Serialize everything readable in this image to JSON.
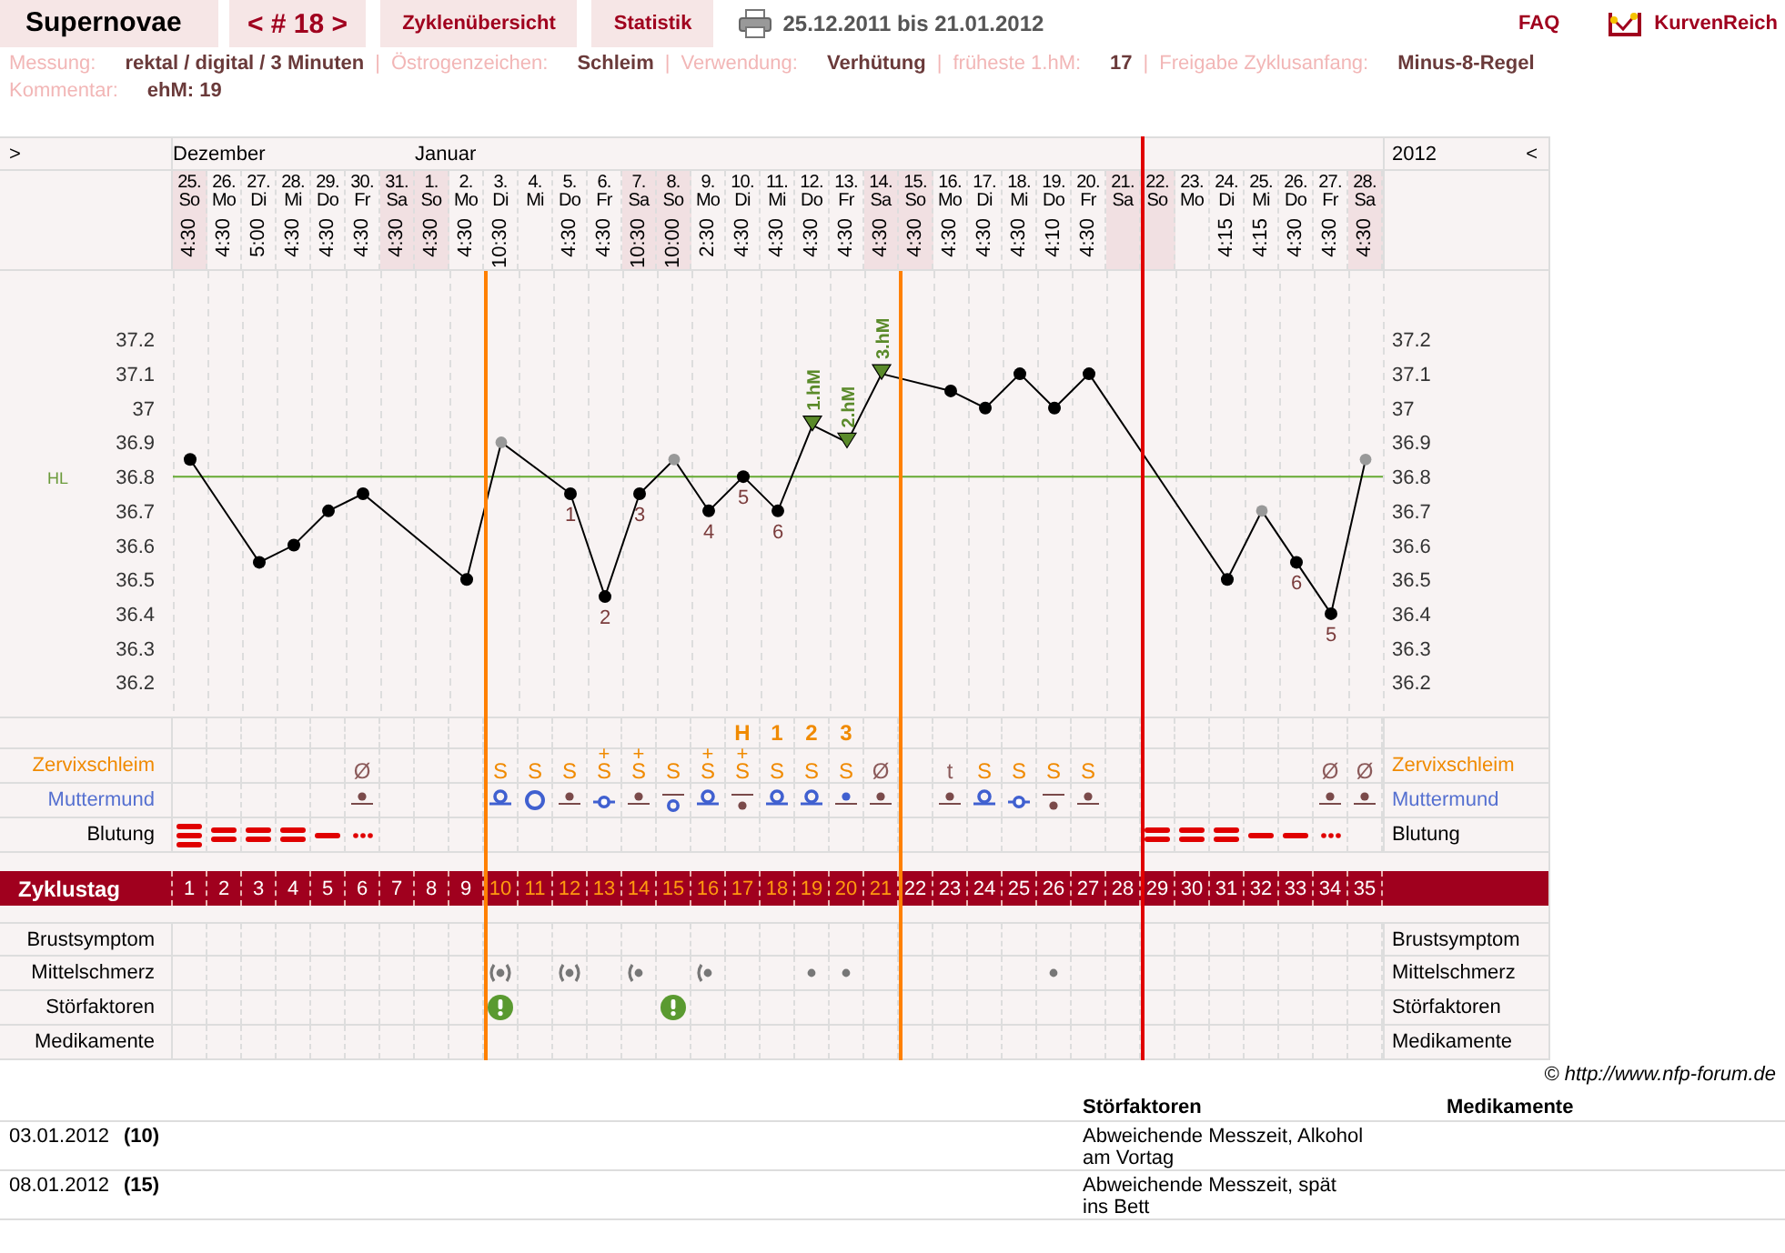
{
  "header": {
    "title": "Supernovae",
    "cycle_nav": "< # 18 >",
    "tabs": [
      {
        "label": "Zyklenübersicht",
        "selected": false
      },
      {
        "label": "Statistik",
        "selected": false
      }
    ],
    "date_range": "25.12.2011 bis 21.01.2012",
    "faq": "FAQ",
    "logo": "KurvenReich"
  },
  "info": [
    [
      {
        "label": "Messung:",
        "value": "rektal / digital / 3 Minuten"
      },
      {
        "sep": "|",
        "label": "Östrogenzeichen:",
        "value": "Schleim"
      },
      {
        "sep": "|",
        "label": "Verwendung:",
        "value": "Verhütung"
      },
      {
        "sep": "|",
        "label": "früheste 1.hM:",
        "value": "17"
      },
      {
        "sep": "|",
        "label": "Freigabe Zyklusanfang:",
        "value": "Minus-8-Regel"
      }
    ],
    [
      {
        "label": "Kommentar:",
        "value": "ehM: 19"
      }
    ]
  ],
  "chart": {
    "nav_left": ">",
    "nav_right": "<",
    "year": "2012",
    "right_axis_labels": [
      "37.2",
      "37.1",
      "37",
      "36.9",
      "36.8",
      "36.7",
      "36.6",
      "36.5",
      "36.4",
      "36.3",
      "36.2"
    ],
    "rows": [
      {
        "kind": "peak"
      },
      {
        "kind": "cervix",
        "label_left": "Zervixschleim",
        "label_right": "Zervixschleim",
        "color": "#f08a00"
      },
      {
        "kind": "os",
        "label_left": "Muttermund",
        "label_right": "Muttermund",
        "color": "#5570d0"
      },
      {
        "kind": "bleeding",
        "label_left": "Blutung",
        "label_right": "Blutung",
        "color": "#000000"
      },
      {
        "kind": "cycle-day",
        "label_left": "Zyklustag"
      },
      {
        "kind": "breast",
        "label_left": "Brustsymptom",
        "label_right": "Brustsymptom",
        "color": "#000000"
      },
      {
        "kind": "pain",
        "label_left": "Mittelschmerz",
        "label_right": "Mittelschmerz",
        "color": "#000000"
      },
      {
        "kind": "disturbance",
        "label_left": "Störfaktoren",
        "label_right": "Störfaktoren",
        "color": "#000000"
      },
      {
        "kind": "medication",
        "label_left": "Medikamente",
        "label_right": "Medikamente",
        "color": "#000000"
      }
    ],
    "days": [
      {
        "month": "Dezember",
        "date": "25.",
        "dow": "So",
        "time": "4:30",
        "weekend": true,
        "cycle_day": "1",
        "fertile": false,
        "bleeding": {
          "kind": "heavy"
        },
        "point": {
          "excluded": false
        }
      },
      {
        "date": "26.",
        "dow": "Mo",
        "time": "4:30",
        "weekend": false,
        "cycle_day": "2",
        "fertile": false,
        "bleeding": {
          "kind": "medium"
        }
      },
      {
        "date": "27.",
        "dow": "Di",
        "time": "5:00",
        "weekend": false,
        "cycle_day": "3",
        "fertile": false,
        "bleeding": {
          "kind": "medium"
        },
        "point": {
          "excluded": false
        }
      },
      {
        "date": "28.",
        "dow": "Mi",
        "time": "4:30",
        "weekend": false,
        "cycle_day": "4",
        "fertile": false,
        "bleeding": {
          "kind": "medium"
        },
        "point": {
          "excluded": false
        }
      },
      {
        "date": "29.",
        "dow": "Do",
        "time": "4:30",
        "weekend": false,
        "cycle_day": "5",
        "fertile": false,
        "bleeding": {
          "kind": "light"
        },
        "point": {
          "excluded": false
        }
      },
      {
        "date": "30.",
        "dow": "Fr",
        "time": "4:30",
        "weekend": false,
        "cycle_day": "6",
        "fertile": false,
        "cervix": {
          "text": "Ø",
          "color": "#8b5a5a"
        },
        "os": {
          "kind": "dot"
        },
        "bleeding": {
          "kind": "spotting"
        },
        "point": {
          "excluded": false
        }
      },
      {
        "date": "31.",
        "dow": "Sa",
        "time": "4:30",
        "weekend": true,
        "cycle_day": "7",
        "fertile": false
      },
      {
        "month": "Januar",
        "date": "1.",
        "dow": "So",
        "time": "4:30",
        "weekend": true,
        "cycle_day": "8",
        "fertile": false
      },
      {
        "date": "2.",
        "dow": "Mo",
        "time": "4:30",
        "weekend": false,
        "cycle_day": "9",
        "fertile": false,
        "point": {
          "excluded": false
        }
      },
      {
        "boundary": {
          "kind": "fertile-start"
        },
        "date": "3.",
        "dow": "Di",
        "time": "10:30",
        "weekend": false,
        "cycle_day": "10",
        "fertile": true,
        "cervix": {
          "text": "S",
          "color": "#f08a00"
        },
        "os": {
          "kind": "ring"
        },
        "pain": {
          "kind": "both"
        },
        "disturbance": {
          "kind": "warning"
        },
        "point": {
          "excluded": true
        }
      },
      {
        "date": "4.",
        "dow": "Mi",
        "weekend": false,
        "cycle_day": "11",
        "fertile": true,
        "cervix": {
          "text": "S",
          "color": "#f08a00"
        },
        "os": {
          "kind": "big-ring"
        }
      },
      {
        "date": "5.",
        "dow": "Do",
        "time": "4:30",
        "weekend": false,
        "cycle_day": "12",
        "fertile": true,
        "cervix": {
          "text": "S",
          "color": "#f08a00"
        },
        "os": {
          "kind": "dot"
        },
        "pain": {
          "kind": "both"
        },
        "point": {
          "excluded": false,
          "label": {
            "kind": "index",
            "text": "1"
          }
        }
      },
      {
        "date": "6.",
        "dow": "Fr",
        "time": "4:30",
        "weekend": false,
        "cycle_day": "13",
        "fertile": true,
        "cervix": {
          "text": "S",
          "mark": "+",
          "color": "#f08a00"
        },
        "os": {
          "kind": "ring-cross"
        },
        "point": {
          "excluded": false,
          "label": {
            "kind": "index",
            "text": "2"
          }
        }
      },
      {
        "date": "7.",
        "dow": "Sa",
        "time": "10:30",
        "weekend": true,
        "cycle_day": "14",
        "fertile": true,
        "cervix": {
          "text": "S",
          "mark": "+",
          "color": "#f08a00"
        },
        "os": {
          "kind": "dot"
        },
        "pain": {
          "kind": "left"
        },
        "point": {
          "excluded": false,
          "label": {
            "kind": "index",
            "text": "3"
          }
        }
      },
      {
        "date": "8.",
        "dow": "So",
        "time": "10:00",
        "weekend": true,
        "cycle_day": "15",
        "fertile": true,
        "cervix": {
          "text": "S",
          "color": "#f08a00"
        },
        "os": {
          "kind": "ring-low"
        },
        "disturbance": {
          "kind": "warning"
        },
        "point": {
          "excluded": true
        }
      },
      {
        "date": "9.",
        "dow": "Mo",
        "time": "2:30",
        "weekend": false,
        "cycle_day": "16",
        "fertile": true,
        "cervix": {
          "text": "S",
          "mark": "+",
          "color": "#f08a00"
        },
        "os": {
          "kind": "ring"
        },
        "pain": {
          "kind": "left"
        },
        "point": {
          "excluded": false,
          "label": {
            "kind": "index",
            "text": "4"
          }
        }
      },
      {
        "date": "10.",
        "dow": "Di",
        "time": "4:30",
        "weekend": false,
        "cycle_day": "17",
        "fertile": true,
        "peak": "H",
        "cervix": {
          "text": "S",
          "mark": "+",
          "color": "#f08a00"
        },
        "os": {
          "kind": "dot-low"
        },
        "point": {
          "excluded": false,
          "label": {
            "kind": "index",
            "text": "5"
          }
        }
      },
      {
        "date": "11.",
        "dow": "Mi",
        "time": "4:30",
        "weekend": false,
        "cycle_day": "18",
        "fertile": true,
        "peak": "1",
        "cervix": {
          "text": "S",
          "color": "#f08a00"
        },
        "os": {
          "kind": "ring"
        },
        "point": {
          "excluded": false,
          "label": {
            "kind": "index",
            "text": "6"
          }
        }
      },
      {
        "date": "12.",
        "dow": "Do",
        "time": "4:30",
        "weekend": false,
        "cycle_day": "19",
        "fertile": true,
        "peak": "2",
        "cervix": {
          "text": "S",
          "color": "#f08a00"
        },
        "os": {
          "kind": "ring"
        },
        "pain": {
          "kind": "dot"
        },
        "point": {
          "excluded": false,
          "label": {
            "kind": "shift",
            "text": "1.hM"
          }
        }
      },
      {
        "date": "13.",
        "dow": "Fr",
        "time": "4:30",
        "weekend": false,
        "cycle_day": "20",
        "fertile": true,
        "peak": "3",
        "cervix": {
          "text": "S",
          "color": "#f08a00"
        },
        "os": {
          "kind": "blue-dot"
        },
        "pain": {
          "kind": "dot"
        },
        "point": {
          "excluded": false,
          "label": {
            "kind": "shift",
            "text": "2.hM"
          }
        }
      },
      {
        "date": "14.",
        "dow": "Sa",
        "time": "4:30",
        "weekend": true,
        "cycle_day": "21",
        "fertile": true,
        "cervix": {
          "text": "Ø",
          "color": "#8b5a5a"
        },
        "os": {
          "kind": "dot"
        },
        "point": {
          "excluded": false,
          "label": {
            "kind": "shift",
            "text": "3.hM"
          }
        }
      },
      {
        "boundary": {
          "kind": "fertile-end"
        },
        "date": "15.",
        "dow": "So",
        "time": "4:30",
        "weekend": true,
        "cycle_day": "22",
        "fertile": false
      },
      {
        "date": "16.",
        "dow": "Mo",
        "time": "4:30",
        "weekend": false,
        "cycle_day": "23",
        "fertile": false,
        "cervix": {
          "text": "t",
          "color": "#8b5a5a"
        },
        "os": {
          "kind": "dot"
        },
        "point": {
          "excluded": false
        }
      },
      {
        "date": "17.",
        "dow": "Di",
        "time": "4:30",
        "weekend": false,
        "cycle_day": "24",
        "fertile": false,
        "cervix": {
          "text": "S",
          "color": "#f08a00"
        },
        "os": {
          "kind": "ring"
        },
        "point": {
          "excluded": false
        }
      },
      {
        "date": "18.",
        "dow": "Mi",
        "time": "4:30",
        "weekend": false,
        "cycle_day": "25",
        "fertile": false,
        "cervix": {
          "text": "S",
          "color": "#f08a00"
        },
        "os": {
          "kind": "ring-cross"
        },
        "point": {
          "excluded": false
        }
      },
      {
        "date": "19.",
        "dow": "Do",
        "time": "4:10",
        "weekend": false,
        "cycle_day": "26",
        "fertile": false,
        "cervix": {
          "text": "S",
          "color": "#f08a00"
        },
        "os": {
          "kind": "dot-low"
        },
        "pain": {
          "kind": "dot"
        },
        "point": {
          "excluded": false
        }
      },
      {
        "date": "20.",
        "dow": "Fr",
        "time": "4:30",
        "weekend": false,
        "cycle_day": "27",
        "fertile": false,
        "cervix": {
          "text": "S",
          "color": "#f08a00"
        },
        "os": {
          "kind": "dot"
        },
        "point": {
          "excluded": false
        }
      },
      {
        "date": "21.",
        "dow": "Sa",
        "weekend": true,
        "cycle_day": "28",
        "fertile": false
      },
      {
        "boundary": {
          "kind": "cycle-end"
        },
        "date": "22.",
        "dow": "So",
        "weekend": true,
        "cycle_day": "29",
        "fertile": false,
        "bleeding": {
          "kind": "medium"
        }
      },
      {
        "date": "23.",
        "dow": "Mo",
        "weekend": false,
        "cycle_day": "30",
        "fertile": false,
        "bleeding": {
          "kind": "medium"
        }
      },
      {
        "date": "24.",
        "dow": "Di",
        "time": "4:15",
        "weekend": false,
        "cycle_day": "31",
        "fertile": false,
        "bleeding": {
          "kind": "medium"
        },
        "point": {
          "excluded": false
        }
      },
      {
        "date": "25.",
        "dow": "Mi",
        "time": "4:15",
        "weekend": false,
        "cycle_day": "32",
        "fertile": false,
        "bleeding": {
          "kind": "light"
        },
        "point": {
          "excluded": true
        }
      },
      {
        "date": "26.",
        "dow": "Do",
        "time": "4:30",
        "weekend": false,
        "cycle_day": "33",
        "fertile": false,
        "bleeding": {
          "kind": "light"
        },
        "point": {
          "excluded": false,
          "label": {
            "kind": "index",
            "text": "6"
          }
        }
      },
      {
        "date": "27.",
        "dow": "Fr",
        "time": "4:30",
        "weekend": false,
        "cycle_day": "34",
        "fertile": false,
        "cervix": {
          "text": "Ø",
          "color": "#8b5a5a"
        },
        "os": {
          "kind": "dot"
        },
        "bleeding": {
          "kind": "spotting"
        },
        "point": {
          "excluded": false,
          "label": {
            "kind": "index",
            "text": "5"
          }
        }
      },
      {
        "date": "28.",
        "dow": "Sa",
        "time": "4:30",
        "weekend": true,
        "cycle_day": "35",
        "fertile": false,
        "cervix": {
          "text": "Ø",
          "color": "#8b5a5a"
        },
        "os": {
          "kind": "dot"
        },
        "point": {
          "excluded": true
        }
      }
    ],
    "chart_data": {
      "type": "line",
      "categories": [
        null,
        null,
        null,
        null,
        null,
        null,
        null,
        null,
        null,
        null,
        null,
        null,
        null,
        null,
        null,
        null,
        null,
        null,
        null,
        null,
        null,
        null,
        null,
        null,
        null,
        null,
        null,
        null,
        null,
        null,
        null,
        null,
        null,
        null,
        null
      ],
      "series": [
        {
          "color": "#000000",
          "marker": "o",
          "values": [
            36.85,
            null,
            36.55,
            36.6,
            36.7,
            36.75,
            null,
            null,
            36.5,
            36.9,
            null,
            36.75,
            36.45,
            36.75,
            36.85,
            36.7,
            36.8,
            36.7,
            36.95,
            36.9,
            37.1,
            null,
            37.05,
            37.0,
            37.1,
            37.0,
            37.1,
            null,
            null,
            null,
            36.5,
            36.7,
            36.55,
            36.4,
            36.85
          ]
        }
      ],
      "ylim": [
        36.1,
        37.4
      ],
      "yticks": [
        36.2,
        36.3,
        36.4,
        36.5,
        36.6,
        36.7,
        36.8,
        36.9,
        37,
        37.1,
        37.2
      ],
      "ref_lines": [
        {
          "axis": "y",
          "value": 36.8,
          "label": "HL"
        }
      ]
    }
  },
  "copyright": "© http://www.nfp-forum.de",
  "notes": {
    "columns": [
      "Störfaktoren",
      "Medikamente"
    ],
    "rows": [
      {
        "date": "03.01.2012",
        "day": "(10)",
        "disturbance": "Abweichende Messzeit, Alkohol am Vortag"
      },
      {
        "date": "08.01.2012",
        "day": "(15)",
        "disturbance": "Abweichende Messzeit, spät ins Bett"
      }
    ]
  }
}
